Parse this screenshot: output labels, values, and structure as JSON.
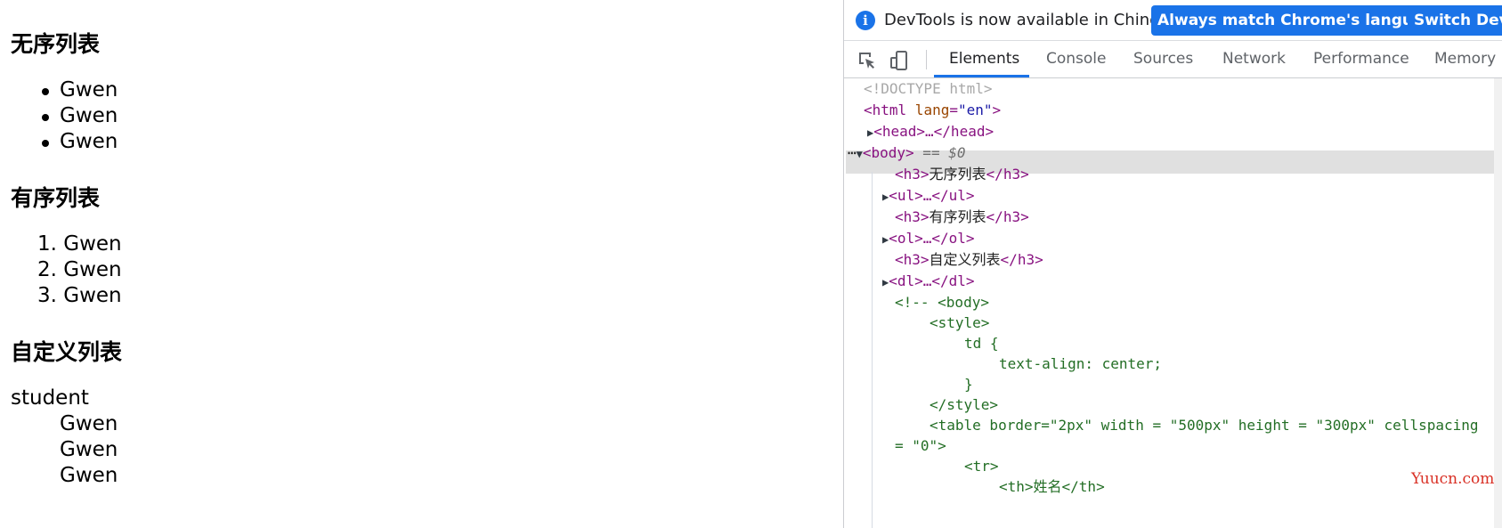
{
  "page": {
    "unordered_heading": "无序列表",
    "unordered_items": [
      "Gwen",
      "Gwen",
      "Gwen"
    ],
    "ordered_heading": "有序列表",
    "ordered_items": [
      "1. Gwen",
      "2. Gwen",
      "3. Gwen"
    ],
    "definition_heading": "自定义列表",
    "definition_term": "student",
    "definition_items": [
      "Gwen",
      "Gwen",
      "Gwen"
    ]
  },
  "devtools": {
    "infobar": {
      "text": "DevTools is now available in Chinese!",
      "match_button": "Always match Chrome's language",
      "switch_button": "Switch DevT"
    },
    "tabs": [
      "Elements",
      "Console",
      "Sources",
      "Network",
      "Performance",
      "Memory"
    ],
    "active_tab": "Elements",
    "dom": {
      "doctype": "<!DOCTYPE html>",
      "html_open": "<html",
      "html_attr": " lang",
      "html_val": "\"en\"",
      "head": "<head>…</head>",
      "body": "<body>",
      "body_eq": " == $0",
      "h3_1": "无序列表",
      "ul": "<ul>…</ul>",
      "h3_2": "有序列表",
      "ol": "<ol>…</ol>",
      "h3_3": "自定义列表",
      "dl": "<dl>…</dl>",
      "c1": "<!-- <body>",
      "c2": "<style>",
      "c3": "td {",
      "c4": "text-align: center;",
      "c5": "}",
      "c6": "</style>",
      "c7": "<table border=\"2px\" width = \"500px\" height = \"300px\" cellspacing",
      "c8": "= \"0\">",
      "c9": "<tr>",
      "c10": "<th>姓名</th>"
    },
    "watermark": "Yuucn.com",
    "colors": {
      "accent": "#1a73e8",
      "tag": "#881280",
      "comment": "#236e25",
      "watermark": "#d93025"
    }
  }
}
